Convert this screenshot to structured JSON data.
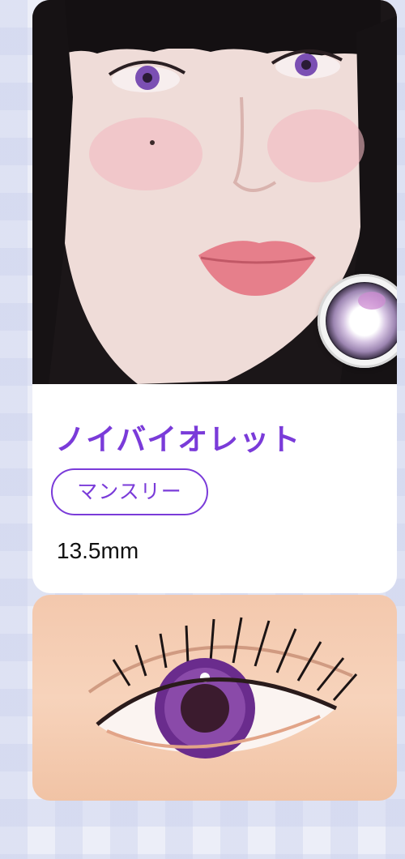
{
  "product": {
    "name": "ノイバイオレット",
    "period": "マンスリー",
    "diameter": "13.5mm"
  },
  "colors": {
    "accent": "#7a3bd9",
    "card_background": "#ffffff",
    "page_background": "#eceef8"
  },
  "images": {
    "model_photo": "model-face-photo",
    "lens_swatch": "lens-swatch",
    "eye_closeup": "eye-closeup-photo"
  }
}
